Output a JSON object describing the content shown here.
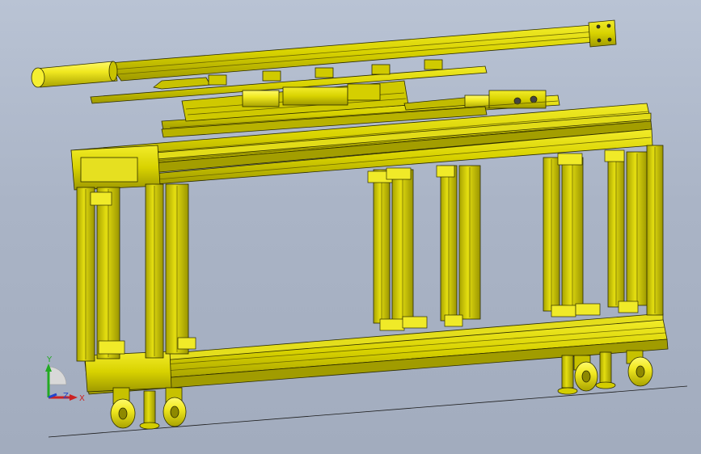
{
  "viewport": {
    "model_color": "#d8d200",
    "model_shade": "#8a8600",
    "edge_color": "#2b2b00",
    "background_top": "#b9c3d4",
    "background_bottom": "#a2acbe"
  },
  "triad": {
    "y_label": "Y",
    "z_label": "Z",
    "x_label": "X",
    "y_color": "#22aa22",
    "z_color": "#2244cc",
    "x_color": "#cc2222"
  }
}
